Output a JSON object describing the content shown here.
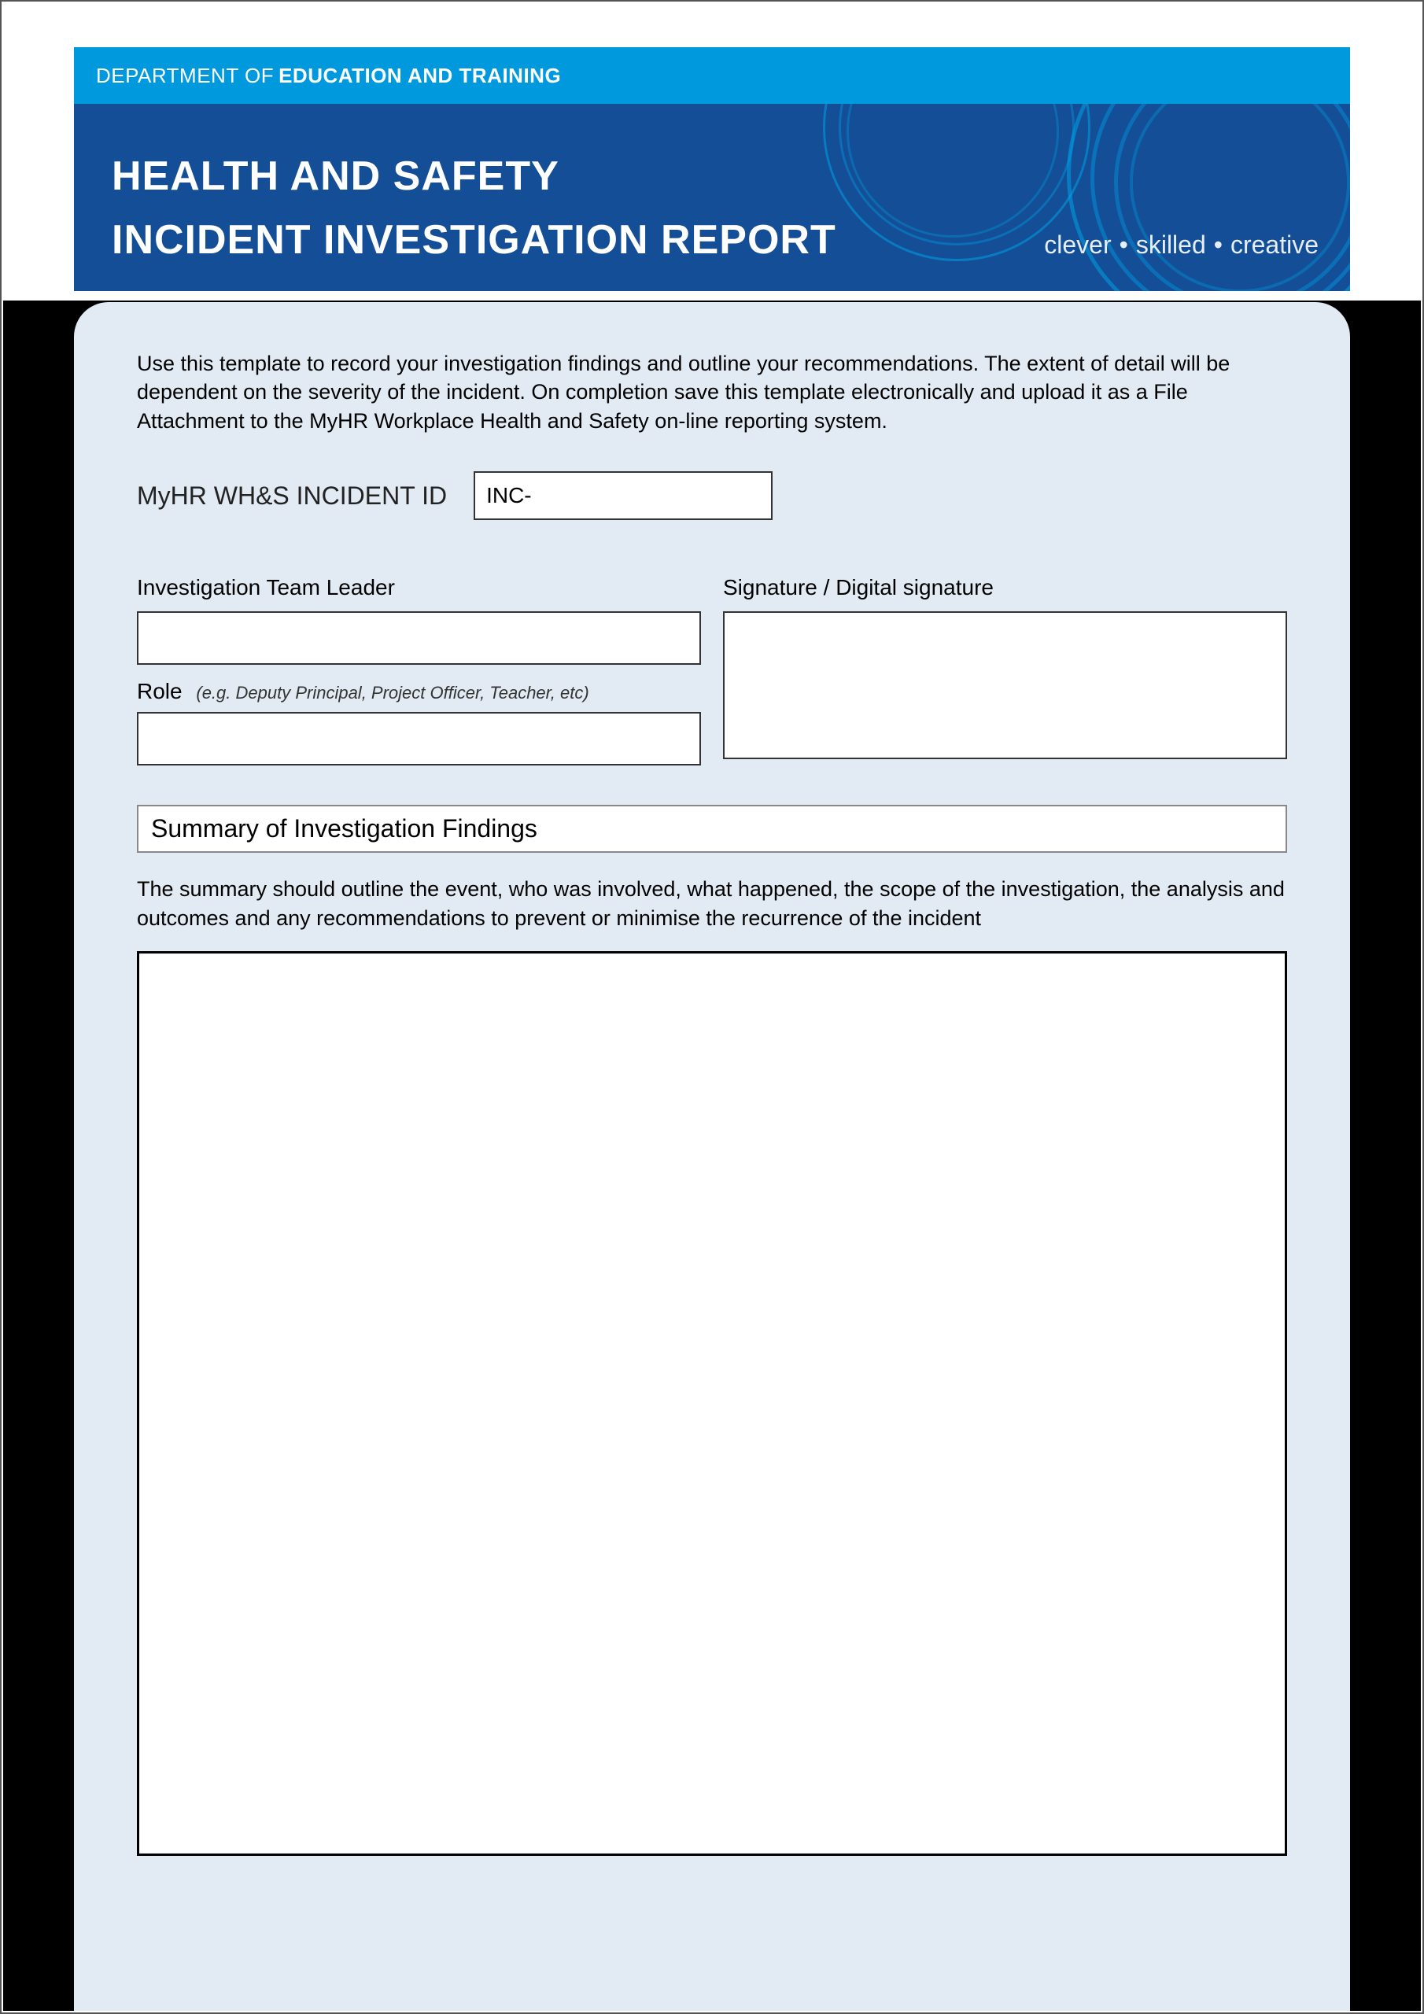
{
  "header": {
    "dept_prefix": "DEPARTMENT OF",
    "dept_name": "EDUCATION AND TRAINING",
    "title_line1": "HEALTH AND SAFETY",
    "title_line2": "INCIDENT INVESTIGATION REPORT",
    "tagline_1": "clever",
    "tagline_2": "skilled",
    "tagline_3": "creative"
  },
  "intro_text": "Use this template to record your investigation findings and outline your recommendations. The extent of detail will be dependent on the severity of the incident. On completion save this template electronically and upload it as a File Attachment to the MyHR Workplace Health and Safety on-line reporting system.",
  "incident_id": {
    "label": "MyHR WH&S INCIDENT ID",
    "value": "INC-"
  },
  "team_leader": {
    "label": "Investigation Team Leader",
    "value": ""
  },
  "signature": {
    "label": "Signature / Digital signature"
  },
  "role": {
    "label": "Role",
    "hint": "(e.g. Deputy Principal, Project Officer, Teacher, etc)",
    "value": ""
  },
  "summary_section": {
    "heading": "Summary of Investigation Findings",
    "description": "The summary should outline the event, who was involved, what happened, the scope of the investigation, the analysis and outcomes and any recommendations to prevent or minimise the recurrence of the incident",
    "value": ""
  }
}
